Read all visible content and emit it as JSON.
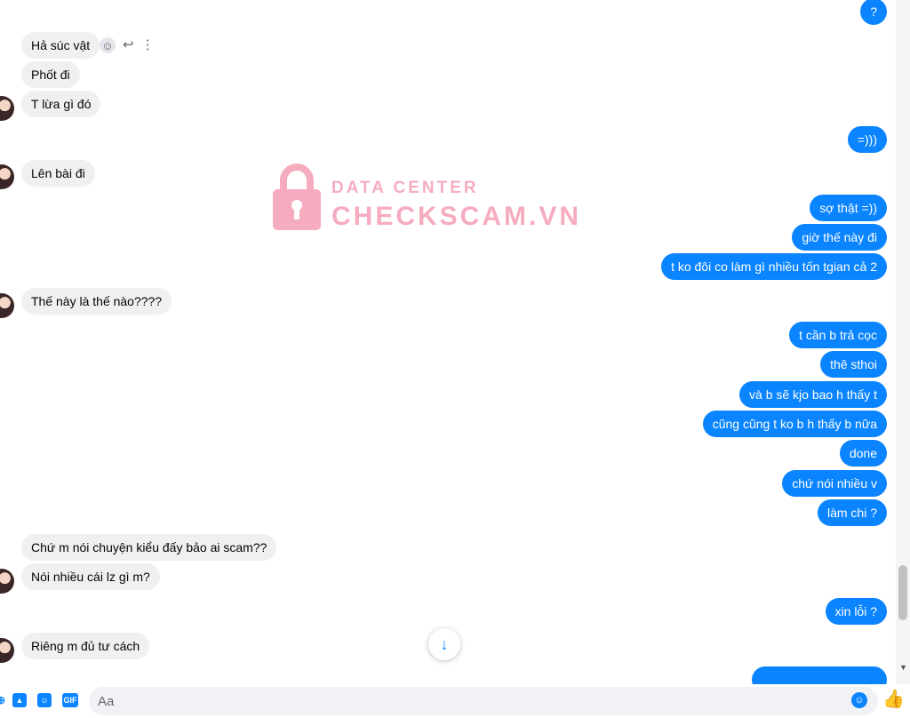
{
  "messages": {
    "incoming": [
      "Hả súc vật",
      "Phốt đi",
      "T lừa gì đó",
      "Lên bài đi",
      "Thế này là thế nào????",
      "Chứ m nói chuyện kiểu đấy bảo ai scam??",
      "Nói nhiều cái lz gì m?",
      "Riêng m đủ tư cách"
    ],
    "outgoing": [
      "?",
      "=)))",
      "sợ thật =))",
      "giờ thế này đi",
      "t ko đôi co làm gì nhiều tốn tgian cả 2",
      "t cần b trả cọc",
      "thê sthoi",
      "và b sẽ kjo bao h thấy t",
      "cũng cũng t ko b h thấy b nữa",
      "done",
      "chứ nói nhiều v",
      "làm chi ?",
      "xin lỗi ?"
    ]
  },
  "watermark": {
    "line1": "DATA CENTER",
    "line2": "CHECKSCAM.VN"
  },
  "composer": {
    "placeholder": "Aa",
    "gif_label": "GIF"
  },
  "icons": {
    "react": "smiley-icon",
    "reply": "reply-icon",
    "more": "more-vertical-icon",
    "scroll_down": "arrow-down-icon",
    "emoji": "emoji-icon",
    "like": "thumbs-up-icon"
  },
  "colors": {
    "outgoing_bubble": "#0a84ff",
    "incoming_bubble": "#f0f0f0",
    "watermark": "#f06a8b"
  }
}
